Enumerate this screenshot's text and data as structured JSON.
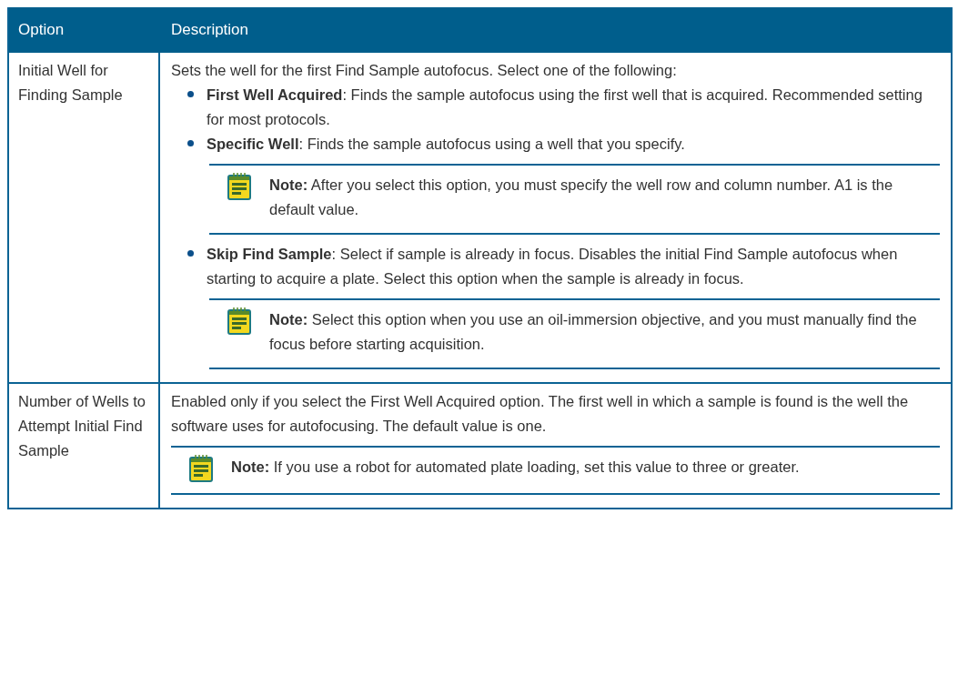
{
  "table": {
    "columns": [
      "Option",
      "Description"
    ],
    "rows": [
      {
        "option": "Initial Well for Finding Sample",
        "description": [
          {
            "kind": "paragraph",
            "text": "Sets the well for the first Find Sample autofocus. Select one of the following:"
          },
          {
            "kind": "bullet",
            "text": "**First Well Acquired**: Finds the sample autofocus using the first well that is acquired. Recommended setting for most protocols."
          },
          {
            "kind": "bullet",
            "text": "**Specific Well**: Finds the sample autofocus using a well that you specify.",
            "notes": [
              "**Note:** After you select this option, you must specify the well row and column number. A1 is the default value."
            ]
          },
          {
            "kind": "bullet",
            "text": "**Skip Find Sample**: Select if sample is already in focus. Disables the initial Find Sample autofocus when starting to acquire a plate. Select this option when the sample is already in focus.",
            "notes": [
              "**Note:** Select this option when you use an oil-immersion objective, and you must manually find the focus before starting acquisition."
            ]
          }
        ]
      },
      {
        "option": "Number of Wells to Attempt Initial Find Sample",
        "description": [
          {
            "kind": "paragraph",
            "text": "Enabled only if you select the First Well Acquired option. The first well in which a sample is found is the well the software uses for autofocusing. The default value is one."
          },
          {
            "kind": "note",
            "text": "**Note:** If you use a robot for automated plate loading, set this value to three or greater."
          }
        ]
      }
    ]
  }
}
